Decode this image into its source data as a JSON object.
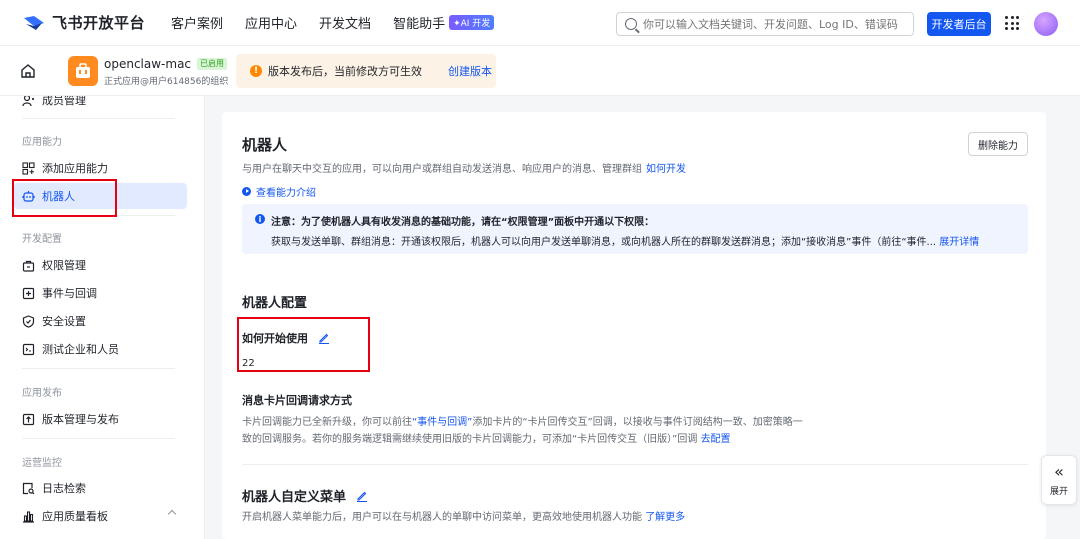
{
  "topbar": {
    "brand": "飞书开放平台",
    "nav": [
      {
        "label": "客户案例"
      },
      {
        "label": "应用中心"
      },
      {
        "label": "开发文档"
      },
      {
        "label": "智能助手",
        "badge": "✦AI 开发"
      }
    ],
    "search_placeholder": "你可以输入文档关键词、开发问题、Log ID、错误码",
    "dev_console": "开发者后台"
  },
  "appbar": {
    "app_name": "openclaw-mac",
    "status": "已启用",
    "app_sub": "正式应用@用户614856的组织",
    "notice_icon": "!",
    "notice": "版本发布后，当前修改方可生效",
    "notice_link": "创建版本"
  },
  "sidebar": {
    "top_item": "成员管理",
    "section_capability": "应用能力",
    "add_capability": "添加应用能力",
    "bot": "机器人",
    "section_dev": "开发配置",
    "permissions": "权限管理",
    "events": "事件与回调",
    "security": "安全设置",
    "test_org": "测试企业和人员",
    "section_release": "应用发布",
    "version_release": "版本管理与发布",
    "section_ops": "运营监控",
    "log_search": "日志检索",
    "quality_dashboard": "应用质量看板"
  },
  "main": {
    "title": "机器人",
    "delete_button": "删除能力",
    "desc": "与用户在聊天中交互的应用，可以向用户或群组自动发送消息、响应用户的消息、管理群组",
    "desc_link": "如何开发",
    "intro_link": "查看能力介绍",
    "tip_icon": "i",
    "tip_title": "注意：为了使机器人具有收发消息的基础功能，请在“权限管理”面板中开通以下权限：",
    "tip_body": "获取与发送单聊、群组消息：开通该权限后，机器人可以向用户发送单聊消息，或向机器人所在的群聊发送群消息；添加“接收消息”事件（前往“事件...",
    "tip_link": "展开详情",
    "config_title": "机器人配置",
    "how_to_start": "如何开始使用",
    "how_to_start_value": "22",
    "card_callback_title": "消息卡片回调请求方式",
    "card_para_1a": "卡片回调能力已全新升级，你可以前往",
    "card_para_1_link": "“事件与回调”",
    "card_para_1b": "添加卡片的“卡片回传交互”回调，以接收与事件订阅结构一致、加密策略一",
    "card_para_2": "致的回调服务。若你的服务端逻辑需继续使用旧版的卡片回调能力，可添加“卡片回传交互（旧版）”回调",
    "card_para_2_link": "去配置",
    "menu_title": "机器人自定义菜单",
    "menu_desc": "开启机器人菜单能力后，用户可以在与机器人的单聊中访问菜单，更高效地使用机器人功能",
    "menu_link": "了解更多"
  },
  "expand": {
    "icon": "«",
    "label": "展开"
  }
}
